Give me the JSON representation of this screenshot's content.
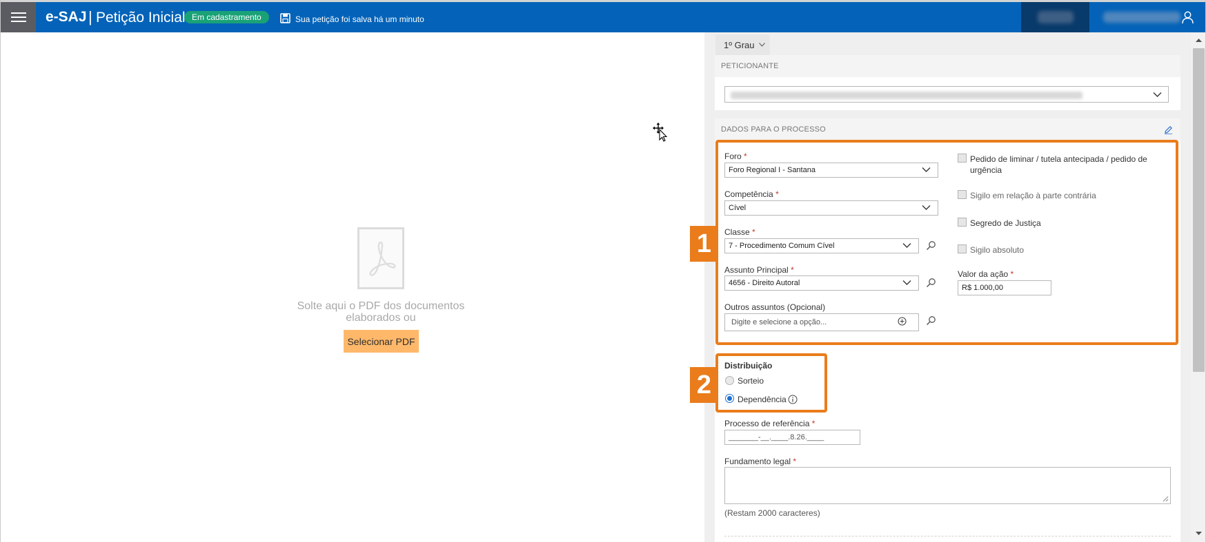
{
  "header": {
    "brand": "e-SAJ",
    "separator": "|",
    "title": "Petição Inicial",
    "status_badge": "Em cadastramento",
    "save_status": "Sua petição foi salva há um minuto",
    "menu_icon": "hamburger-icon",
    "save_icon": "floppy-disk-icon",
    "user_icon": "user-icon",
    "bg_color": "#0463b8"
  },
  "dropzone": {
    "text": "Solte aqui o PDF dos documentos elaborados ou",
    "button_label": "Selecionar PDF",
    "icon": "pdf-file-icon"
  },
  "panel": {
    "grau_tab": "1º Grau",
    "peticionante": {
      "heading": "PETICIONANTE"
    },
    "dados": {
      "heading": "DADOS PARA O PROCESSO",
      "foro": {
        "label": "Foro",
        "value": "Foro Regional I - Santana"
      },
      "competencia": {
        "label": "Competência",
        "value": "Cível"
      },
      "classe": {
        "label": "Classe",
        "value": "7 - Procedimento Comum Cível"
      },
      "assunto": {
        "label": "Assunto Principal",
        "value": "4656 - Direito Autoral"
      },
      "outros": {
        "label": "Outros assuntos (Opcional)",
        "placeholder": "Digite e selecione a opção..."
      },
      "checks": {
        "liminar_line1": "Pedido de liminar / tutela antecipada / pedido de",
        "liminar_line2": "urgência",
        "sigilo_parte": "Sigilo em relação à parte contrária",
        "segredo": "Segredo de Justiça",
        "sigilo_absoluto": "Sigilo absoluto"
      },
      "valor": {
        "label": "Valor da ação",
        "value": "R$ 1.000,00"
      },
      "required_mark": "*",
      "distribuicao": {
        "label": "Distribuição",
        "option_sorteio": "Sorteio",
        "option_dependencia": "Dependência",
        "selected": "Dependência"
      },
      "processo_ref": {
        "label": "Processo de referência",
        "mask": "_______-__.____.8.26.____"
      },
      "fundamento": {
        "label": "Fundamento legal",
        "counter": "(Restam 2000 caracteres)"
      }
    },
    "annotations": {
      "box1": "1",
      "box2": "2",
      "color": "#ea7c1b"
    }
  }
}
